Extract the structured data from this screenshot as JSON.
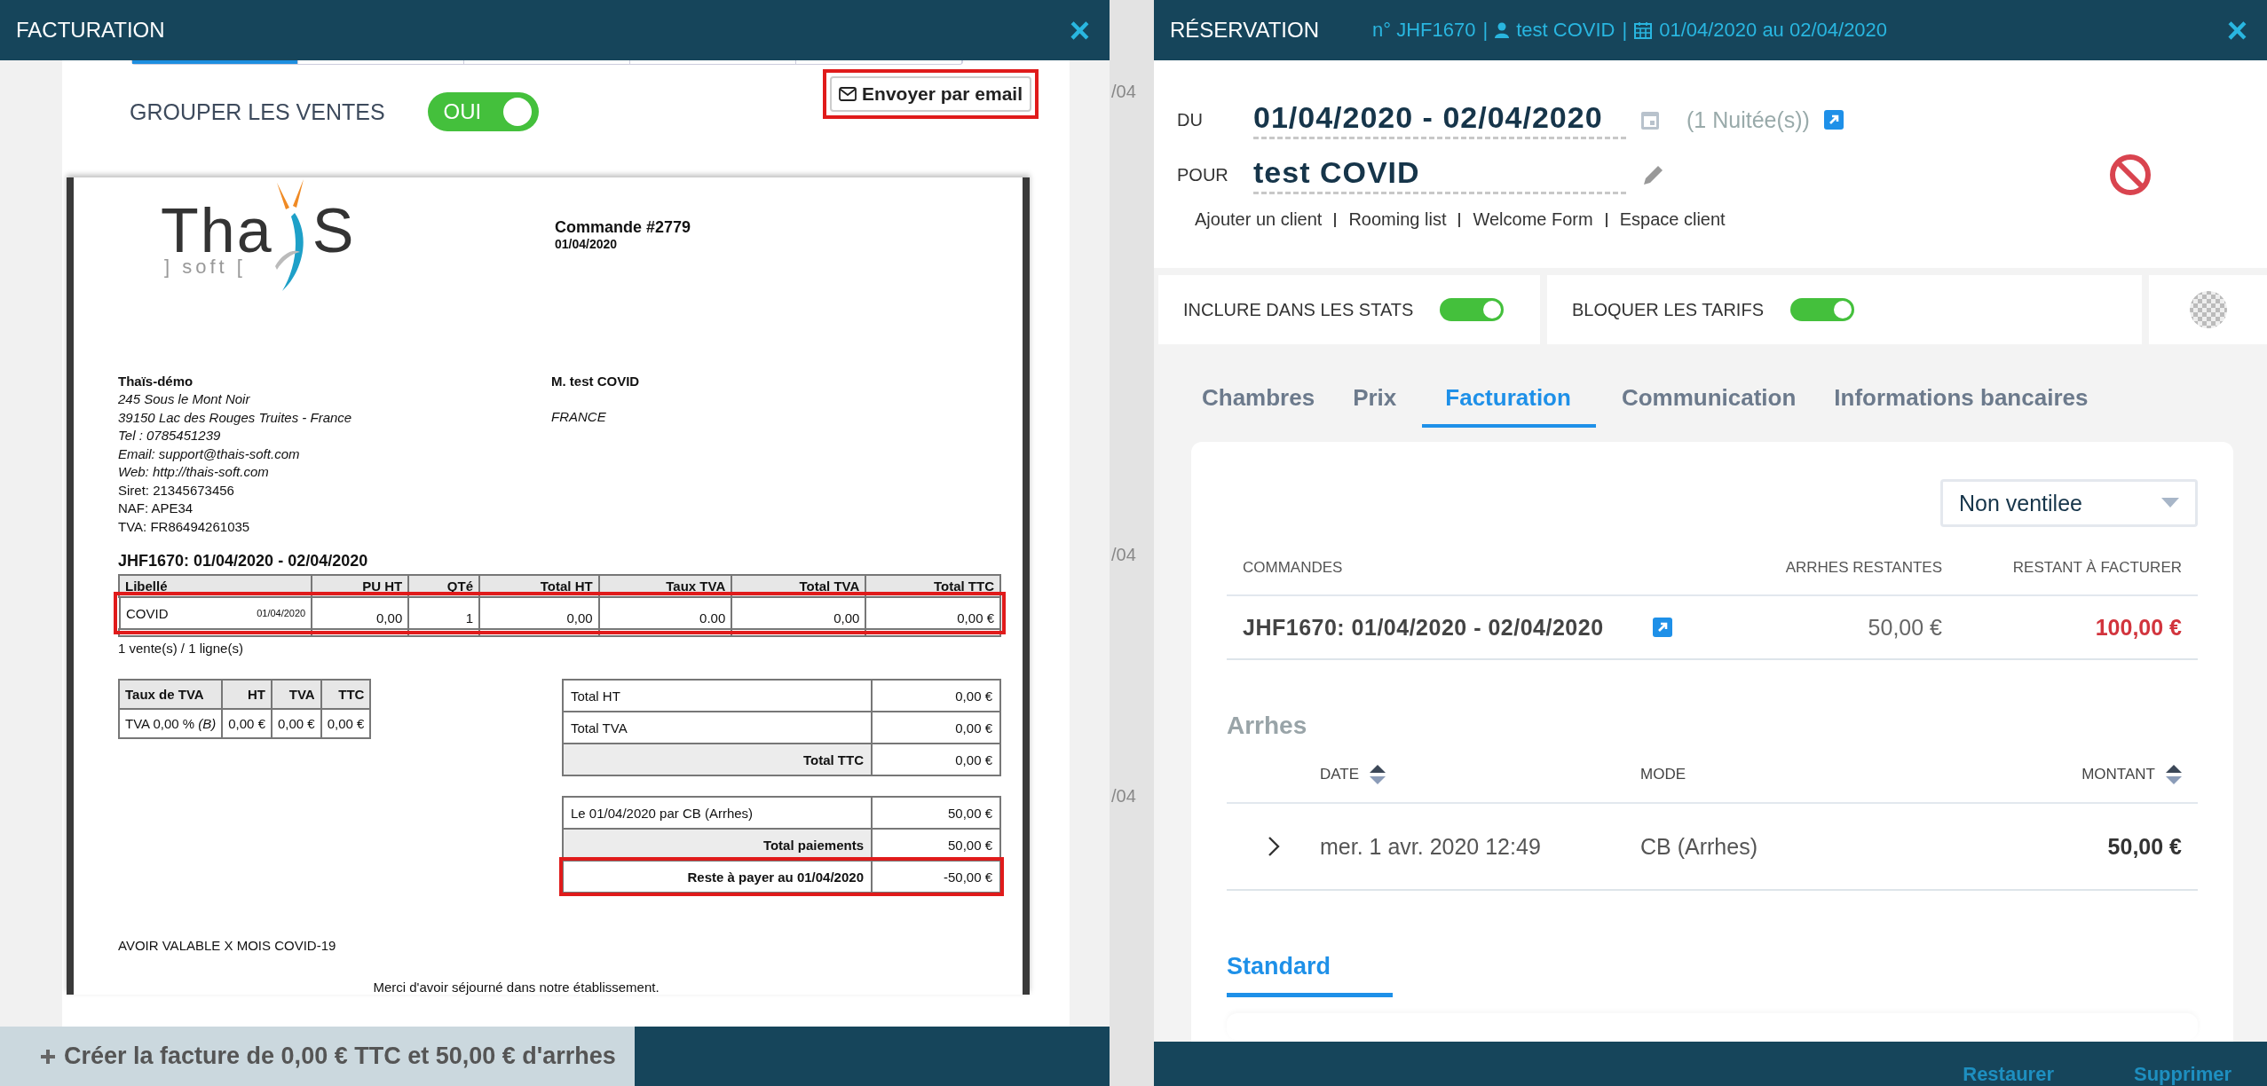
{
  "strip": {
    "texts": [
      "/04",
      "/04",
      "/04"
    ]
  },
  "billing": {
    "title": "FACTURATION",
    "close": "×",
    "group_sales": {
      "label": "GROUPER LES VENTES",
      "on": true,
      "value": "OUI"
    },
    "email_button": {
      "label": "Envoyer par email",
      "highlighted": true
    },
    "invoice": {
      "logo": {
        "main": "Tha",
        "end": "S",
        "sub": "] soft ["
      },
      "order_title": "Commande #2779",
      "order_date": "01/04/2020",
      "seller": [
        {
          "text": "Thaïs-démo",
          "kind": "bold"
        },
        {
          "text": "245 Sous le Mont Noir",
          "kind": "italic"
        },
        {
          "text": "39150 Lac des Rouges Truites - France",
          "kind": "italic"
        },
        {
          "text": "Tel : 0785451239",
          "kind": "italic"
        },
        {
          "text": "Email: support@thais-soft.com",
          "kind": "italic"
        },
        {
          "text": "Web: http://thais-soft.com",
          "kind": "italic"
        },
        {
          "text": "Siret: 21345673456",
          "kind": "plain"
        },
        {
          "text": "NAF: APE34",
          "kind": "plain"
        },
        {
          "text": "TVA: FR86494261035",
          "kind": "plain"
        }
      ],
      "client": [
        {
          "text": "M. test COVID",
          "kind": "bold"
        },
        {
          "text": "FRANCE",
          "kind": "italic"
        }
      ],
      "stay_title": "JHF1670: 01/04/2020 - 02/04/2020",
      "lines_columns": [
        "Libellé",
        "PU HT",
        "QTé",
        "Total HT",
        "Taux TVA",
        "Total TVA",
        "Total TTC"
      ],
      "lines": [
        {
          "label": "COVID",
          "date": "01/04/2020",
          "cells": [
            "0,00",
            "1",
            "0,00",
            "0.00",
            "0,00",
            "0,00 €"
          ],
          "highlighted": true
        }
      ],
      "lines_count": "1 vente(s) / 1 ligne(s)",
      "vat_columns": [
        "Taux de TVA",
        "HT",
        "TVA",
        "TTC"
      ],
      "vat_rows": [
        [
          "TVA 0,00 % *(B)*",
          "0,00 €",
          "0,00 €",
          "0,00 €"
        ]
      ],
      "totals": [
        {
          "label": "Total HT",
          "value": "0,00 €",
          "kind": "plain",
          "highlighted": false
        },
        {
          "label": "Total TVA",
          "value": "0,00 €",
          "kind": "plain",
          "highlighted": false
        },
        {
          "label": "Total TTC",
          "value": "0,00 €",
          "kind": "total",
          "highlighted": false
        }
      ],
      "payments": [
        {
          "label": "Le 01/04/2020 par CB (Arrhes)",
          "value": "50,00 €",
          "kind": "plain",
          "highlighted": false
        },
        {
          "label": "Total paiements",
          "value": "50,00 €",
          "kind": "total",
          "highlighted": false
        },
        {
          "label": "Reste à payer au 01/04/2020",
          "value": "-50,00 €",
          "kind": "total",
          "highlighted": true
        }
      ],
      "note": "AVOIR VALABLE X MOIS COVID-19",
      "thanks": "Merci d'avoir séjourné dans notre établissement."
    },
    "create_button": "Créer la facture de 0,00 € TTC et 50,00 € d'arrhes"
  },
  "reservation": {
    "title": "RÉSERVATION",
    "close": "×",
    "info": {
      "number": "n° JHF1670",
      "guest": "test COVID",
      "dates": "01/04/2020 au 02/04/2020",
      "separator": "|"
    },
    "du_label": "DU",
    "dates": "01/04/2020 - 02/04/2020",
    "nights": "(1 Nuitée(s))",
    "pour_label": "POUR",
    "guest": "test COVID",
    "links": [
      "Ajouter un client",
      "Rooming list",
      "Welcome Form",
      "Espace client"
    ],
    "toggles": [
      {
        "label": "INCLURE DANS LES STATS",
        "on": true
      },
      {
        "label": "BLOQUER LES TARIFS",
        "on": true
      }
    ],
    "tabs": [
      {
        "label": "Chambres",
        "selected": false
      },
      {
        "label": "Prix",
        "selected": false
      },
      {
        "label": "Facturation",
        "selected": true
      },
      {
        "label": "Communication",
        "selected": false
      },
      {
        "label": "Informations bancaires",
        "selected": false
      }
    ],
    "select": "Non ventilee",
    "orders": {
      "columns": [
        "COMMANDES",
        "ARRHES RESTANTES",
        "RESTANT À FACTURER"
      ],
      "rows": [
        {
          "order": "JHF1670: 01/04/2020 - 02/04/2020",
          "deposit": "50,00 €",
          "remaining": "100,00 €"
        }
      ]
    },
    "deposits": {
      "title": "Arrhes",
      "columns": [
        {
          "label": "DATE",
          "sortable": true
        },
        {
          "label": "MODE",
          "sortable": false
        },
        {
          "label": "MONTANT",
          "sortable": true
        }
      ],
      "rows": [
        {
          "date": "mer. 1 avr. 2020 12:49",
          "mode": "CB (Arrhes)",
          "amount": "50,00 €",
          "expanded": false
        }
      ]
    },
    "subtabs": [
      {
        "label": "Standard",
        "selected": true
      }
    ],
    "footer": [
      "Restaurer",
      "Supprimer"
    ]
  }
}
